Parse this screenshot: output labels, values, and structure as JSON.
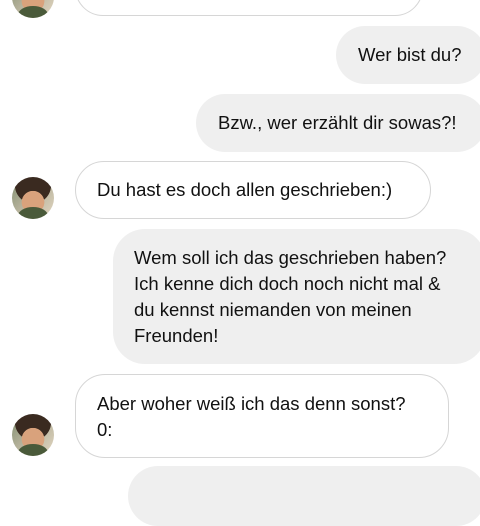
{
  "chat": {
    "messages": [
      {
        "id": "m1",
        "direction": "outgoing",
        "text": "Wer bist du?"
      },
      {
        "id": "m2",
        "direction": "outgoing",
        "text": "Bzw., wer erzählt dir sowas?!"
      },
      {
        "id": "m3",
        "direction": "incoming",
        "text": "Du hast es doch allen geschrieben:)"
      },
      {
        "id": "m4",
        "direction": "outgoing",
        "text": "Wem soll ich das geschrieben haben?\nIch kenne dich doch noch nicht mal &\ndu kennst niemanden von meinen\nFreunden!"
      },
      {
        "id": "m5",
        "direction": "incoming",
        "text": "Aber woher weiß ich das denn sonst?\n0:"
      }
    ]
  },
  "colors": {
    "incoming_bubble_bg": "#ffffff",
    "incoming_bubble_border": "#d6d6d6",
    "outgoing_bubble_bg": "#efefef",
    "text": "#111111"
  }
}
